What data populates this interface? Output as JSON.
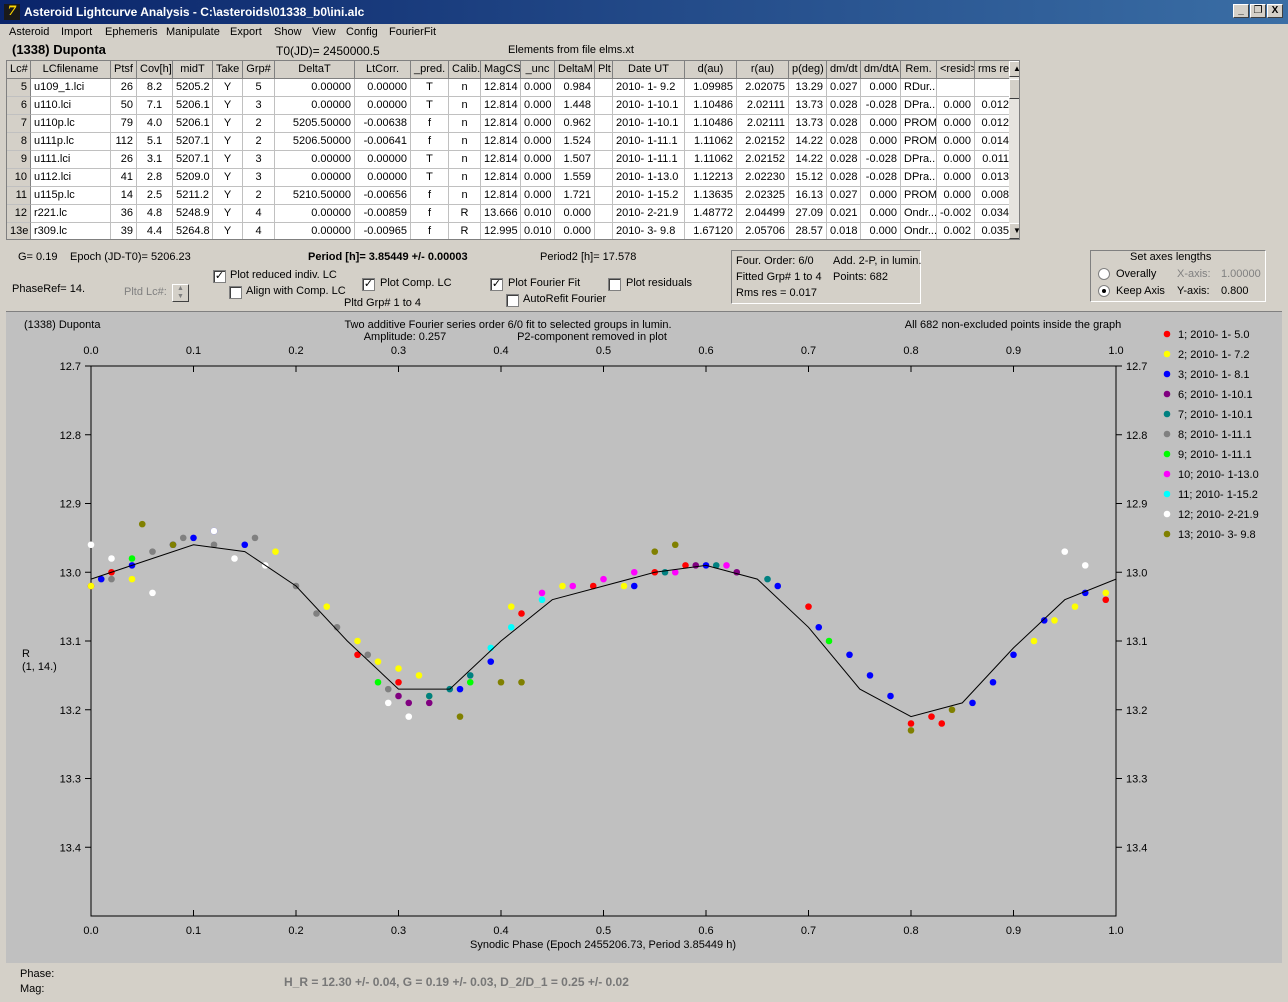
{
  "window": {
    "title": "Asteroid Lightcurve Analysis - C:\\asteroids\\01338_b0\\ini.alc",
    "buttons": [
      "_",
      "❐",
      "X"
    ]
  },
  "menu": [
    "Asteroid",
    "Import",
    "Ephemeris",
    "Manipulate",
    "Export",
    "Show",
    "View",
    "Config",
    "FourierFit"
  ],
  "header": {
    "object": "(1338) Duponta",
    "t0": "T0(JD)= 2450000.5",
    "elements": "Elements from file elms.xt"
  },
  "table": {
    "columns": [
      "Lc#",
      "LCfilename",
      "Ptsf",
      "Cov[h]",
      "midT",
      "Take",
      "Grp#",
      "DeltaT",
      "LtCorr.",
      "_pred.",
      "Calib.",
      "MagCS",
      "_unc",
      "DeltaM",
      "Plt",
      "Date UT",
      "d(au)",
      "r(au)",
      "p(deg)",
      "dm/dt",
      "dm/dtA",
      "Rem.",
      "<resid>",
      "rms res"
    ],
    "rows": [
      [
        "5",
        "u109_1.lci",
        "26",
        "8.2",
        "5205.2",
        "Y",
        "5",
        "0.00000",
        "0.00000",
        "T",
        "n",
        "12.814",
        "0.000",
        "0.984",
        "",
        "2010- 1- 9.2",
        "1.09985",
        "2.02075",
        "13.29",
        "0.027",
        "0.000",
        "RDur...",
        "",
        ""
      ],
      [
        "6",
        "u110.lci",
        "50",
        "7.1",
        "5206.1",
        "Y",
        "3",
        "0.00000",
        "0.00000",
        "T",
        "n",
        "12.814",
        "0.000",
        "1.448",
        "",
        "2010- 1-10.1",
        "1.10486",
        "2.02111",
        "13.73",
        "0.028",
        "-0.028",
        "DPra...",
        "0.000",
        "0.012"
      ],
      [
        "7",
        "u110p.lc",
        "79",
        "4.0",
        "5206.1",
        "Y",
        "2",
        "5205.50000",
        "-0.00638",
        "f",
        "n",
        "12.814",
        "0.000",
        "0.962",
        "",
        "2010- 1-10.1",
        "1.10486",
        "2.02111",
        "13.73",
        "0.028",
        "0.000",
        "PROM",
        "0.000",
        "0.012"
      ],
      [
        "8",
        "u111p.lc",
        "112",
        "5.1",
        "5207.1",
        "Y",
        "2",
        "5206.50000",
        "-0.00641",
        "f",
        "n",
        "12.814",
        "0.000",
        "1.524",
        "",
        "2010- 1-11.1",
        "1.11062",
        "2.02152",
        "14.22",
        "0.028",
        "0.000",
        "PROM",
        "0.000",
        "0.014"
      ],
      [
        "9",
        "u111.lci",
        "26",
        "3.1",
        "5207.1",
        "Y",
        "3",
        "0.00000",
        "0.00000",
        "T",
        "n",
        "12.814",
        "0.000",
        "1.507",
        "",
        "2010- 1-11.1",
        "1.11062",
        "2.02152",
        "14.22",
        "0.028",
        "-0.028",
        "DPra...",
        "0.000",
        "0.011"
      ],
      [
        "10",
        "u112.lci",
        "41",
        "2.8",
        "5209.0",
        "Y",
        "3",
        "0.00000",
        "0.00000",
        "T",
        "n",
        "12.814",
        "0.000",
        "1.559",
        "",
        "2010- 1-13.0",
        "1.12213",
        "2.02230",
        "15.12",
        "0.028",
        "-0.028",
        "DPra...",
        "0.000",
        "0.013"
      ],
      [
        "11",
        "u115p.lc",
        "14",
        "2.5",
        "5211.2",
        "Y",
        "2",
        "5210.50000",
        "-0.00656",
        "f",
        "n",
        "12.814",
        "0.000",
        "1.721",
        "",
        "2010- 1-15.2",
        "1.13635",
        "2.02325",
        "16.13",
        "0.027",
        "0.000",
        "PROM",
        "0.000",
        "0.008"
      ],
      [
        "12",
        "r221.lc",
        "36",
        "4.8",
        "5248.9",
        "Y",
        "4",
        "0.00000",
        "-0.00859",
        "f",
        "R",
        "13.666",
        "0.010",
        "0.000",
        "",
        "2010- 2-21.9",
        "1.48772",
        "2.04499",
        "27.09",
        "0.021",
        "0.000",
        "Ondr...",
        "-0.002",
        "0.034"
      ],
      [
        "13e",
        "r309.lc",
        "39",
        "4.4",
        "5264.8",
        "Y",
        "4",
        "0.00000",
        "-0.00965",
        "f",
        "R",
        "12.995",
        "0.010",
        "0.000",
        "",
        "2010- 3- 9.8",
        "1.67120",
        "2.05706",
        "28.57",
        "0.018",
        "0.000",
        "Ondr...",
        "0.002",
        "0.035"
      ]
    ]
  },
  "info": {
    "g": "G= 0.19",
    "epoch": "Epoch (JD-T0)= 5206.23",
    "period": "Period [h]= 3.85449 +/- 0.00003",
    "period2": "Period2 [h]= 17.578",
    "phaseref": "PhaseRef= 14.",
    "pltd_lc": "Pltd Lc#:",
    "pltd_grp": "Pltd Grp#  1   to   4",
    "four_order": "Four. Order:  6/0",
    "fitted_grp": "Fitted Grp# 1 to 4",
    "rms_res": "Rms res     = 0.017",
    "add2p": "Add. 2-P, in lumin.",
    "points": "Points: 682"
  },
  "checkboxes": {
    "plot_reduced": {
      "label": "Plot reduced indiv. LC",
      "checked": true
    },
    "align_comp": {
      "label": "Align with Comp. LC",
      "checked": false
    },
    "plot_comp": {
      "label": "Plot Comp. LC",
      "checked": true
    },
    "plot_fourier": {
      "label": "Plot Fourier Fit",
      "checked": true
    },
    "autorefit": {
      "label": "AutoRefit Fourier",
      "checked": false
    },
    "plot_resid": {
      "label": "Plot residuals",
      "checked": false
    }
  },
  "axes_panel": {
    "title": "Set axes lengths",
    "overally": "Overally",
    "keep_axis": "Keep Axis",
    "xaxis_label": "X-axis:",
    "xaxis_value": "1.00000",
    "yaxis_label": "Y-axis:",
    "yaxis_value": "0.800",
    "selected": "Keep Axis"
  },
  "plot": {
    "name": "(1338) Duponta",
    "fit_line1": "Two additive Fourier series order 6/0 fit to selected groups in lumin.",
    "fit_line2": "Amplitude: 0.257",
    "fit_line3": "P2-component removed in plot",
    "points_note": "All 682 non-excluded points inside the graph",
    "ylabel1": "R",
    "ylabel2": "(1, 14.)",
    "xlabel": "Synodic Phase (Epoch 2455206.73, Period 3.85449 h)",
    "curve_color": "#000000"
  },
  "chart_data": {
    "type": "scatter",
    "title": "(1338) Duponta",
    "xlabel": "Synodic Phase (Epoch 2455206.73, Period 3.85449 h)",
    "ylabel": "R (1, 14.)",
    "xlim": [
      0.0,
      1.0
    ],
    "ylim": [
      12.7,
      13.5
    ],
    "y_inverted": true,
    "xticks": [
      "0.0",
      "0.1",
      "0.2",
      "0.3",
      "0.4",
      "0.5",
      "0.6",
      "0.7",
      "0.8",
      "0.9",
      "1.0"
    ],
    "yticks": [
      "12.7",
      "12.8",
      "12.9",
      "13.0",
      "13.1",
      "13.2",
      "13.3",
      "13.4"
    ],
    "grid": false,
    "legend": "right",
    "fit_curve": {
      "phase": [
        0.0,
        0.05,
        0.1,
        0.15,
        0.2,
        0.25,
        0.3,
        0.35,
        0.4,
        0.45,
        0.5,
        0.55,
        0.6,
        0.65,
        0.7,
        0.75,
        0.8,
        0.85,
        0.9,
        0.95,
        1.0
      ],
      "mag": [
        13.01,
        12.985,
        12.96,
        12.97,
        13.02,
        13.1,
        13.17,
        13.17,
        13.1,
        13.04,
        13.02,
        13.0,
        12.99,
        13.01,
        13.08,
        13.17,
        13.21,
        13.19,
        13.11,
        13.04,
        13.01
      ]
    },
    "series": [
      {
        "name": "1; 2010- 1- 5.0",
        "color": "#ff0000",
        "x": [
          0.0,
          0.02,
          0.26,
          0.3,
          0.42,
          0.49,
          0.55,
          0.58,
          0.7,
          0.8,
          0.82,
          0.83,
          0.99
        ],
        "y": [
          13.02,
          13.0,
          13.12,
          13.16,
          13.06,
          13.02,
          13.0,
          12.99,
          13.05,
          13.22,
          13.21,
          13.22,
          13.04
        ]
      },
      {
        "name": "2; 2010- 1- 7.2",
        "color": "#ffff00",
        "x": [
          0.0,
          0.04,
          0.18,
          0.23,
          0.26,
          0.28,
          0.3,
          0.32,
          0.33,
          0.41,
          0.46,
          0.52,
          0.92,
          0.94,
          0.96,
          0.99
        ],
        "y": [
          13.02,
          13.01,
          12.97,
          13.05,
          13.1,
          13.13,
          13.14,
          13.15,
          13.18,
          13.05,
          13.02,
          13.02,
          13.1,
          13.07,
          13.05,
          13.03
        ]
      },
      {
        "name": "3; 2010- 1- 8.1",
        "color": "#0000ff",
        "x": [
          0.01,
          0.04,
          0.08,
          0.1,
          0.12,
          0.15,
          0.36,
          0.39,
          0.53,
          0.6,
          0.67,
          0.71,
          0.74,
          0.76,
          0.78,
          0.86,
          0.88,
          0.9,
          0.93,
          0.97
        ],
        "y": [
          13.01,
          12.99,
          12.96,
          12.95,
          12.94,
          12.96,
          13.17,
          13.13,
          13.02,
          12.99,
          13.02,
          13.08,
          13.12,
          13.15,
          13.18,
          13.19,
          13.16,
          13.12,
          13.07,
          13.03
        ]
      },
      {
        "name": "6; 2010- 1-10.1",
        "color": "#800080",
        "x": [
          0.3,
          0.31,
          0.33,
          0.59,
          0.63
        ],
        "y": [
          13.18,
          13.19,
          13.19,
          12.99,
          13.0
        ]
      },
      {
        "name": "7; 2010- 1-10.1",
        "color": "#008080",
        "x": [
          0.33,
          0.35,
          0.37,
          0.56,
          0.61,
          0.66
        ],
        "y": [
          13.18,
          13.17,
          13.15,
          13.0,
          12.99,
          13.01
        ]
      },
      {
        "name": "8; 2010- 1-11.1",
        "color": "#808080",
        "x": [
          0.02,
          0.06,
          0.09,
          0.12,
          0.16,
          0.2,
          0.22,
          0.24,
          0.27,
          0.29
        ],
        "y": [
          13.01,
          12.97,
          12.95,
          12.96,
          12.95,
          13.02,
          13.06,
          13.08,
          13.12,
          13.17
        ]
      },
      {
        "name": "9; 2010- 1-11.1",
        "color": "#00ff00",
        "x": [
          0.04,
          0.28,
          0.37,
          0.72
        ],
        "y": [
          12.98,
          13.16,
          13.16,
          13.1
        ]
      },
      {
        "name": "10; 2010- 1-13.0",
        "color": "#ff00ff",
        "x": [
          0.44,
          0.47,
          0.5,
          0.53,
          0.57,
          0.62
        ],
        "y": [
          13.03,
          13.02,
          13.01,
          13.0,
          13.0,
          12.99
        ]
      },
      {
        "name": "11; 2010- 1-15.2",
        "color": "#00ffff",
        "x": [
          0.39,
          0.41,
          0.44
        ],
        "y": [
          13.11,
          13.08,
          13.04
        ]
      },
      {
        "name": "12; 2010- 2-21.9",
        "color": "#ffffff",
        "x": [
          0.0,
          0.02,
          0.06,
          0.12,
          0.14,
          0.17,
          0.29,
          0.31,
          0.95,
          0.97
        ],
        "y": [
          12.96,
          12.98,
          13.03,
          12.94,
          12.98,
          12.99,
          13.19,
          13.21,
          12.97,
          12.99
        ]
      },
      {
        "name": "13; 2010- 3- 9.8",
        "color": "#808000",
        "x": [
          0.05,
          0.08,
          0.36,
          0.4,
          0.42,
          0.55,
          0.57,
          0.8,
          0.84
        ],
        "y": [
          12.93,
          12.96,
          13.21,
          13.16,
          13.16,
          12.97,
          12.96,
          13.23,
          13.2
        ]
      }
    ]
  },
  "status": {
    "phase_label": "Phase:",
    "mag_label": "Mag:",
    "result": "H_R = 12.30 +/- 0.04, G = 0.19 +/- 0.03, D_2/D_1 = 0.25 +/- 0.02"
  }
}
